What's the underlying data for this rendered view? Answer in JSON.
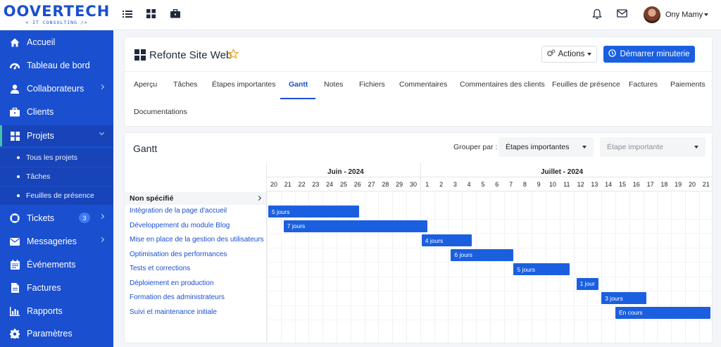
{
  "brand": {
    "name": "OOVERTECH",
    "tagline": "< IT CONSULTING />",
    "color": "#1a4fd0"
  },
  "topbar": {
    "icons": [
      "list-icon",
      "grid-icon",
      "briefcase-icon",
      "bell-icon",
      "mail-icon"
    ],
    "user_name": "Ony Mamy"
  },
  "sidebar": {
    "items": [
      {
        "label": "Accueil",
        "icon": "home-icon"
      },
      {
        "label": "Tableau de bord",
        "icon": "dashboard-icon"
      },
      {
        "label": "Collaborateurs",
        "icon": "user-icon"
      },
      {
        "label": "Clients",
        "icon": "briefcase-icon"
      },
      {
        "label": "Projets",
        "icon": "grid-icon"
      },
      {
        "label": "Tickets",
        "icon": "lifebuoy-icon",
        "badge": "3"
      },
      {
        "label": "Messageries",
        "icon": "mail-icon"
      },
      {
        "label": "Événements",
        "icon": "calendar-icon"
      },
      {
        "label": "Factures",
        "icon": "file-icon"
      },
      {
        "label": "Rapports",
        "icon": "bar-chart-icon"
      },
      {
        "label": "Paramètres",
        "icon": "gear-icon"
      }
    ],
    "sub_items": [
      "Tous les projets",
      "Tâches",
      "Feuilles de présence"
    ]
  },
  "project": {
    "title": "Refonte Site Web",
    "actions_label": "Actions",
    "timer_label": "Démarrer minuterie",
    "tabs": [
      "Aperçu",
      "Tâches",
      "Étapes importantes",
      "Gantt",
      "Notes",
      "Fichiers",
      "Commentaires",
      "Commentaires des clients",
      "Feuilles de présence",
      "Factures",
      "Paiements",
      "Documentations"
    ],
    "active_tab": "Gantt"
  },
  "gantt": {
    "title": "Gantt",
    "group_by_label": "Grouper par :",
    "group_by_value": "Étapes importantes",
    "milestone_placeholder": "Étape importante",
    "months": [
      "Juin - 2024",
      "Juillet - 2024"
    ],
    "days": [
      "20",
      "21",
      "22",
      "23",
      "24",
      "25",
      "26",
      "27",
      "28",
      "29",
      "30",
      "1",
      "2",
      "3",
      "4",
      "5",
      "6",
      "7",
      "8",
      "9",
      "10",
      "11",
      "12",
      "13",
      "14",
      "15",
      "16",
      "17",
      "18",
      "19",
      "20",
      "21"
    ],
    "group_name": "Non spécifié",
    "tasks": [
      {
        "name": "Intégration de la page d'accueil",
        "start": 0,
        "span": 6.5,
        "label": "5 jours"
      },
      {
        "name": "Développement du module Blog",
        "start": 1.1,
        "span": 10.3,
        "label": "7 jours"
      },
      {
        "name": "Mise en place de la gestion des utilisateurs",
        "start": 11,
        "span": 3.6,
        "label": "4 jours"
      },
      {
        "name": "Optimisation des performances",
        "start": 13.1,
        "span": 4.5,
        "label": "6 jours"
      },
      {
        "name": "Tests et corrections",
        "start": 17.6,
        "span": 4,
        "label": "5 jours"
      },
      {
        "name": "Déploiement en production",
        "start": 22.1,
        "span": 1.6,
        "label": "1 jour"
      },
      {
        "name": "Formation des administrateurs",
        "start": 23.9,
        "span": 3.2,
        "label": "3 jours"
      },
      {
        "name": "Suivi et maintenance initiale",
        "start": 24.9,
        "span": 6.8,
        "label": "En cours"
      }
    ],
    "bar_color": "#1a5fe0"
  }
}
